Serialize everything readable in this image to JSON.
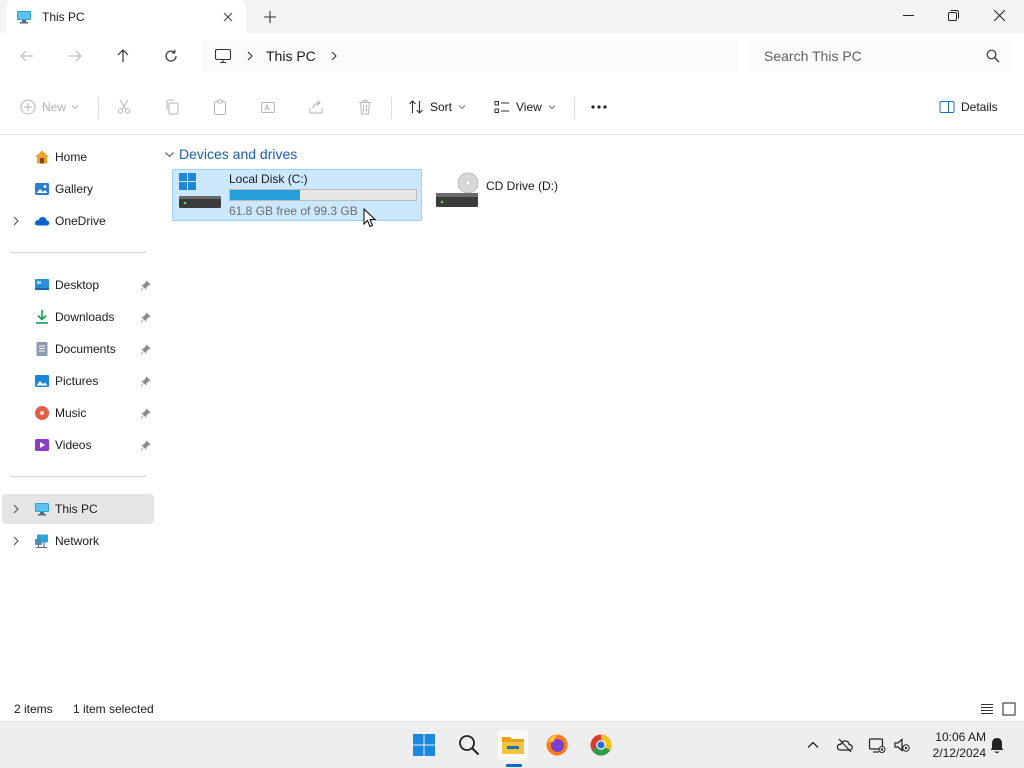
{
  "window": {
    "tab_title": "This PC",
    "tab_icon": "this-pc-icon"
  },
  "address": {
    "breadcrumb_location": "This PC",
    "search_placeholder": "Search This PC"
  },
  "commands": {
    "new_label": "New",
    "sort_label": "Sort",
    "view_label": "View",
    "details_label": "Details"
  },
  "nav": {
    "top": [
      {
        "label": "Home",
        "icon": "home-icon"
      },
      {
        "label": "Gallery",
        "icon": "gallery-icon"
      },
      {
        "label": "OneDrive",
        "icon": "onedrive-icon"
      }
    ],
    "quick_access": [
      {
        "label": "Desktop",
        "icon": "desktop-icon"
      },
      {
        "label": "Downloads",
        "icon": "downloads-icon"
      },
      {
        "label": "Documents",
        "icon": "documents-icon"
      },
      {
        "label": "Pictures",
        "icon": "pictures-icon"
      },
      {
        "label": "Music",
        "icon": "music-icon"
      },
      {
        "label": "Videos",
        "icon": "videos-icon"
      }
    ],
    "bottom": [
      {
        "label": "This PC",
        "icon": "this-pc-icon",
        "selected": true
      },
      {
        "label": "Network",
        "icon": "network-icon"
      }
    ]
  },
  "content": {
    "group_title": "Devices and drives",
    "drives": [
      {
        "name": "Local Disk (C:)",
        "free_text": "61.8 GB free of 99.3 GB",
        "used_fraction": 0.378,
        "selected": true
      },
      {
        "name": "CD Drive (D:)"
      }
    ]
  },
  "status": {
    "item_count": "2 items",
    "selection": "1 item selected"
  },
  "clock": {
    "time": "10:06 AM",
    "date": "2/12/2024"
  },
  "colors": {
    "accent": "#0067c0",
    "selection_bg": "#cce8ff",
    "usage_bar": "#26a0da"
  }
}
